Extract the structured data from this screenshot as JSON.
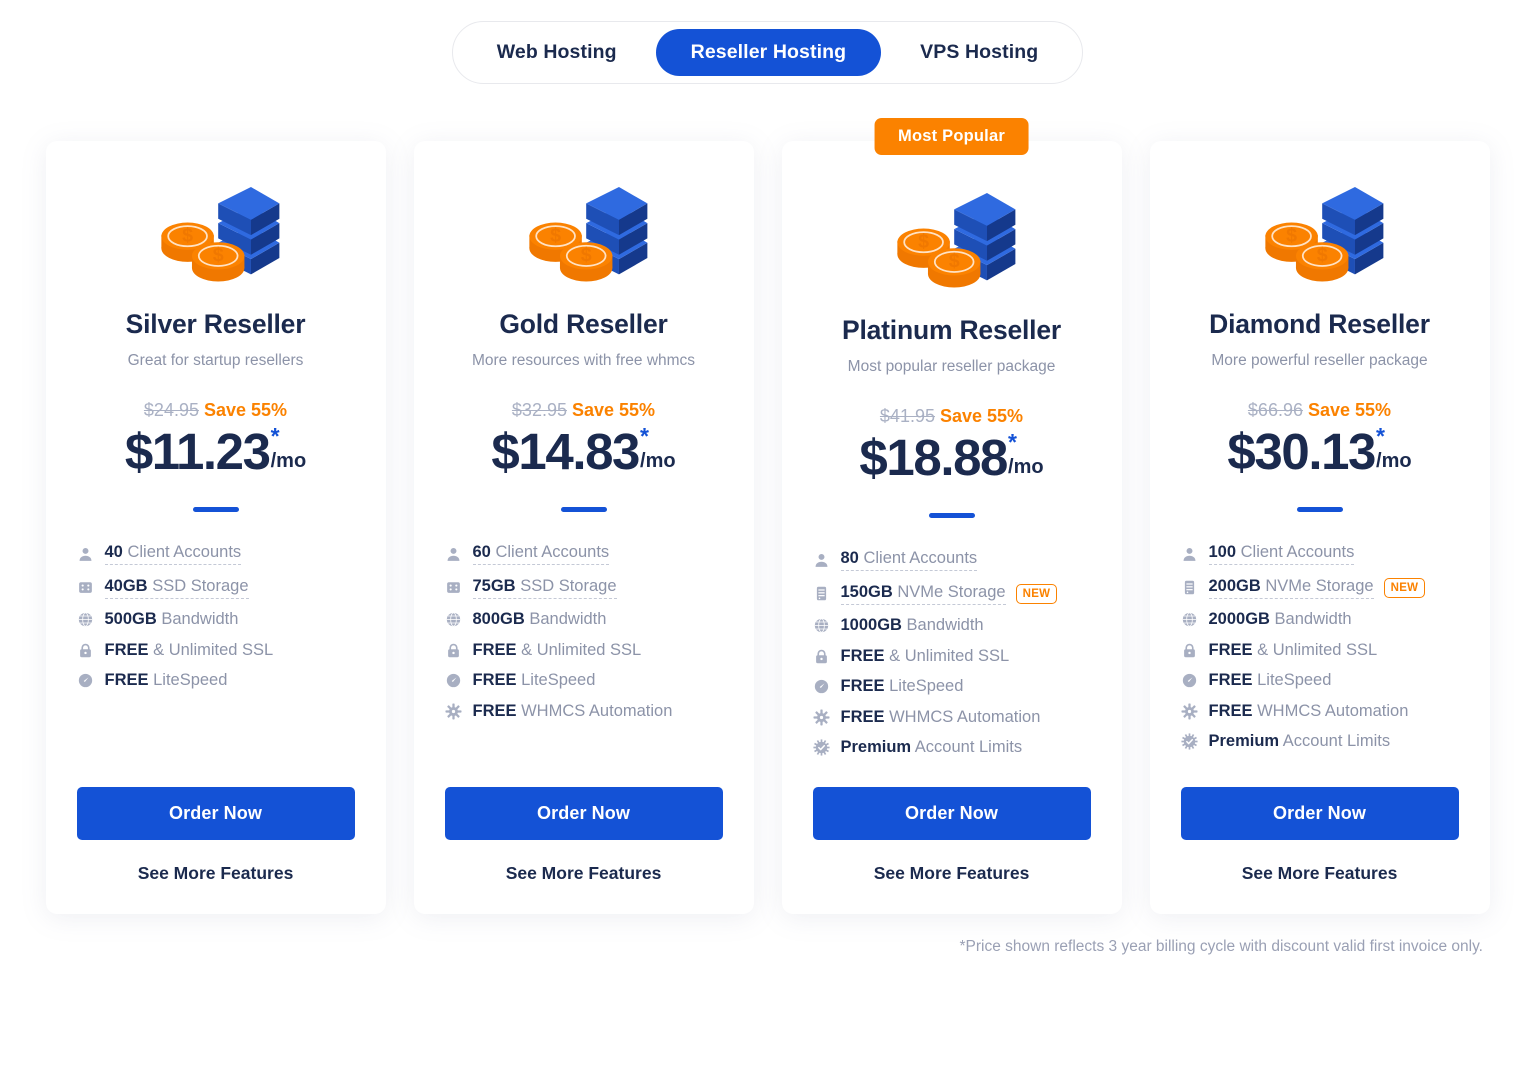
{
  "tabs": {
    "items": [
      {
        "label": "Web Hosting",
        "active": false
      },
      {
        "label": "Reseller Hosting",
        "active": true
      },
      {
        "label": "VPS Hosting",
        "active": false
      }
    ]
  },
  "colors": {
    "brand_blue": "#1452d6",
    "accent_orange": "#fb8200",
    "heading_navy": "#1b2a4e",
    "muted_gray": "#8c93a8"
  },
  "badge_label": "Most Popular",
  "new_tag": "NEW",
  "cta": {
    "order_label": "Order Now",
    "more_label": "See More Features"
  },
  "footnote": "*Price shown reflects 3 year billing cycle with discount valid first invoice only.",
  "plans": [
    {
      "name": "Silver Reseller",
      "subtitle": "Great for startup resellers",
      "old_price": "$24.95",
      "save": "Save 55%",
      "price": "$11.23",
      "asterisk": "*",
      "per": "/mo",
      "featured": false,
      "features": [
        {
          "icon": "user-icon",
          "bold": "40",
          "rest": " Client Accounts",
          "tooltip": true,
          "new": false
        },
        {
          "icon": "ssd-icon",
          "bold": "40GB",
          "rest": " SSD Storage",
          "tooltip": true,
          "new": false
        },
        {
          "icon": "globe-icon",
          "bold": "500GB",
          "rest": " Bandwidth",
          "tooltip": false,
          "new": false
        },
        {
          "icon": "lock-icon",
          "bold": "FREE",
          "rest": " & Unlimited SSL",
          "tooltip": false,
          "new": false
        },
        {
          "icon": "speed-icon",
          "bold": "FREE",
          "rest": " LiteSpeed",
          "tooltip": false,
          "new": false
        }
      ]
    },
    {
      "name": "Gold Reseller",
      "subtitle": "More resources with free whmcs",
      "old_price": "$32.95",
      "save": "Save 55%",
      "price": "$14.83",
      "asterisk": "*",
      "per": "/mo",
      "featured": false,
      "features": [
        {
          "icon": "user-icon",
          "bold": "60",
          "rest": " Client Accounts",
          "tooltip": true,
          "new": false
        },
        {
          "icon": "ssd-icon",
          "bold": "75GB",
          "rest": " SSD Storage",
          "tooltip": true,
          "new": false
        },
        {
          "icon": "globe-icon",
          "bold": "800GB",
          "rest": " Bandwidth",
          "tooltip": false,
          "new": false
        },
        {
          "icon": "lock-icon",
          "bold": "FREE",
          "rest": " & Unlimited SSL",
          "tooltip": false,
          "new": false
        },
        {
          "icon": "speed-icon",
          "bold": "FREE",
          "rest": " LiteSpeed",
          "tooltip": false,
          "new": false
        },
        {
          "icon": "gear-icon",
          "bold": "FREE",
          "rest": " WHMCS Automation",
          "tooltip": false,
          "new": false
        }
      ]
    },
    {
      "name": "Platinum Reseller",
      "subtitle": "Most popular reseller package",
      "old_price": "$41.95",
      "save": "Save 55%",
      "price": "$18.88",
      "asterisk": "*",
      "per": "/mo",
      "featured": true,
      "features": [
        {
          "icon": "user-icon",
          "bold": "80",
          "rest": " Client Accounts",
          "tooltip": true,
          "new": false
        },
        {
          "icon": "nvme-icon",
          "bold": "150GB",
          "rest": " NVMe Storage",
          "tooltip": true,
          "new": true
        },
        {
          "icon": "globe-icon",
          "bold": "1000GB",
          "rest": " Bandwidth",
          "tooltip": false,
          "new": false
        },
        {
          "icon": "lock-icon",
          "bold": "FREE",
          "rest": " & Unlimited SSL",
          "tooltip": false,
          "new": false
        },
        {
          "icon": "speed-icon",
          "bold": "FREE",
          "rest": " LiteSpeed",
          "tooltip": false,
          "new": false
        },
        {
          "icon": "gear-icon",
          "bold": "FREE",
          "rest": " WHMCS Automation",
          "tooltip": false,
          "new": false
        },
        {
          "icon": "badge-check-icon",
          "bold": "Premium",
          "rest": " Account Limits",
          "tooltip": false,
          "new": false
        }
      ]
    },
    {
      "name": "Diamond Reseller",
      "subtitle": "More powerful reseller package",
      "old_price": "$66.96",
      "save": "Save 55%",
      "price": "$30.13",
      "asterisk": "*",
      "per": "/mo",
      "featured": false,
      "features": [
        {
          "icon": "user-icon",
          "bold": "100",
          "rest": " Client Accounts",
          "tooltip": true,
          "new": false
        },
        {
          "icon": "nvme-icon",
          "bold": "200GB",
          "rest": " NVMe Storage",
          "tooltip": true,
          "new": true
        },
        {
          "icon": "globe-icon",
          "bold": "2000GB",
          "rest": " Bandwidth",
          "tooltip": false,
          "new": false
        },
        {
          "icon": "lock-icon",
          "bold": "FREE",
          "rest": " & Unlimited SSL",
          "tooltip": false,
          "new": false
        },
        {
          "icon": "speed-icon",
          "bold": "FREE",
          "rest": " LiteSpeed",
          "tooltip": false,
          "new": false
        },
        {
          "icon": "gear-icon",
          "bold": "FREE",
          "rest": " WHMCS Automation",
          "tooltip": false,
          "new": false
        },
        {
          "icon": "badge-check-icon",
          "bold": "Premium",
          "rest": " Account Limits",
          "tooltip": false,
          "new": false
        }
      ]
    }
  ]
}
